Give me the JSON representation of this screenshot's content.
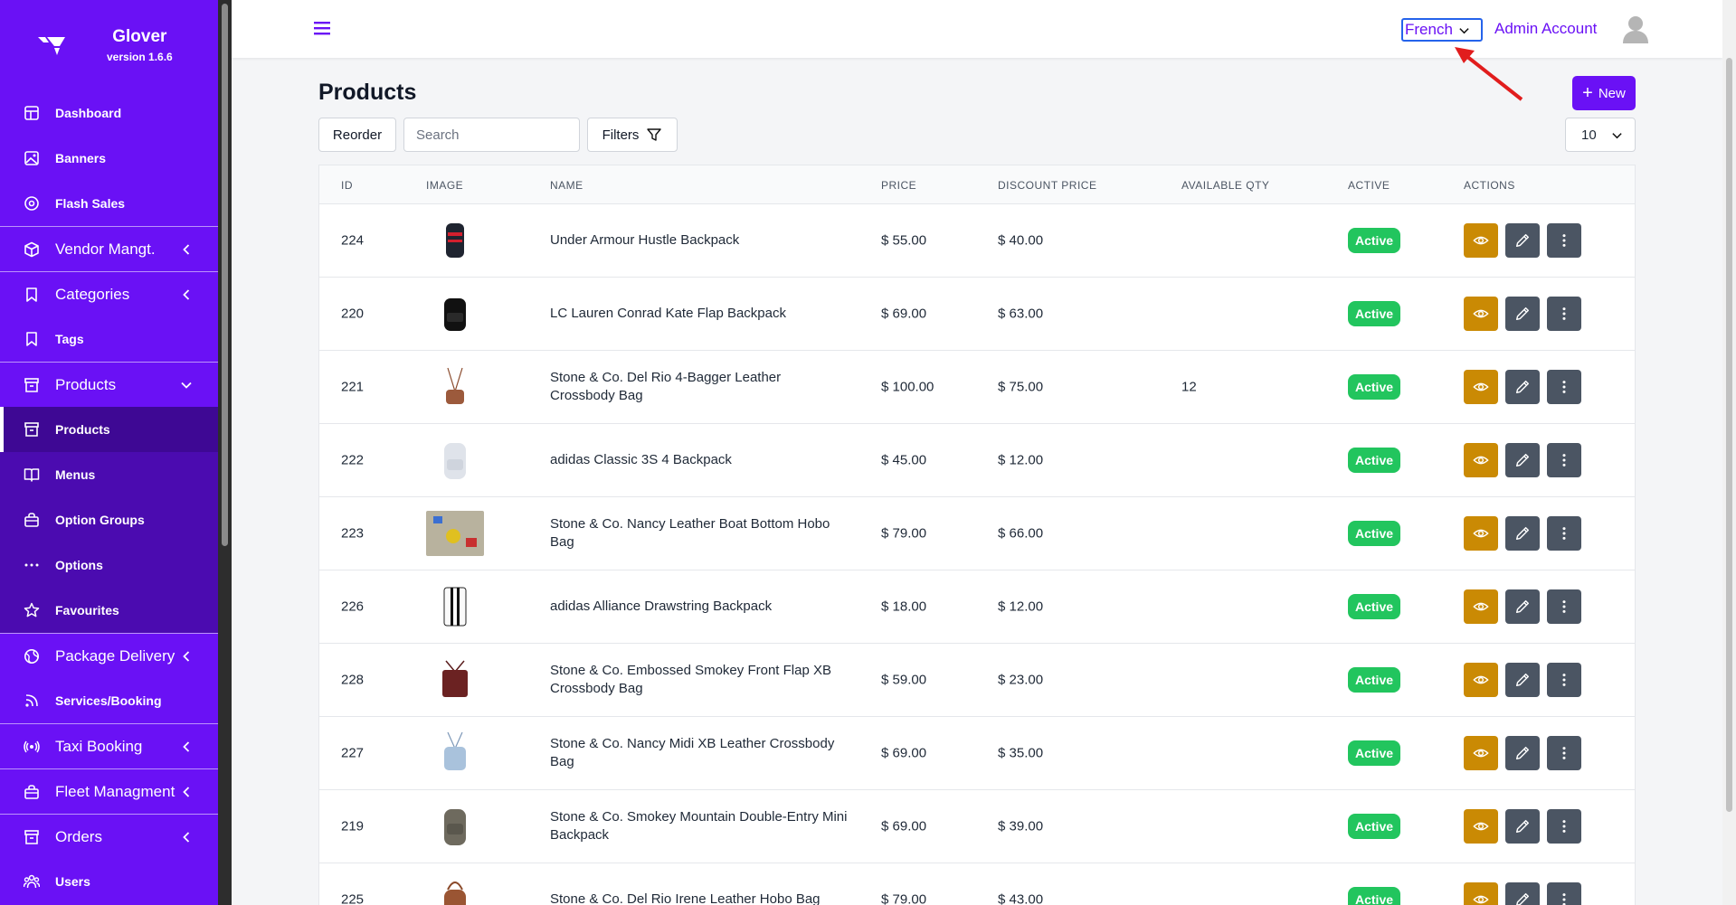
{
  "app": {
    "name": "Glover",
    "version": "version 1.6.6"
  },
  "sidebar": {
    "items": [
      {
        "label": "Dashboard",
        "icon": "dashboard-icon",
        "size": "small"
      },
      {
        "label": "Banners",
        "icon": "image-icon",
        "size": "small"
      },
      {
        "label": "Flash Sales",
        "icon": "flash-icon",
        "size": "small"
      },
      {
        "label": "Vendor Mangt.",
        "icon": "cube-icon",
        "size": "big",
        "chevron": "left"
      },
      {
        "label": "Categories",
        "icon": "bookmark-icon",
        "size": "big",
        "chevron": "left"
      },
      {
        "label": "Tags",
        "icon": "bookmark-icon",
        "size": "small"
      },
      {
        "label": "Products",
        "icon": "archive-icon",
        "size": "big",
        "chevron": "down"
      },
      {
        "label": "Products",
        "icon": "archive-icon",
        "size": "small",
        "active": true
      },
      {
        "label": "Menus",
        "icon": "book-icon",
        "size": "small"
      },
      {
        "label": "Option Groups",
        "icon": "bag-icon",
        "size": "small"
      },
      {
        "label": "Options",
        "icon": "dots-icon",
        "size": "small"
      },
      {
        "label": "Favourites",
        "icon": "star-icon",
        "size": "small"
      },
      {
        "label": "Package Delivery",
        "icon": "globe-icon",
        "size": "big",
        "chevron": "left"
      },
      {
        "label": "Services/Booking",
        "icon": "rss-icon",
        "size": "small"
      },
      {
        "label": "Taxi Booking",
        "icon": "broadcast-icon",
        "size": "big",
        "chevron": "left"
      },
      {
        "label": "Fleet Managment",
        "icon": "bag-icon",
        "size": "big",
        "chevron": "left"
      },
      {
        "label": "Orders",
        "icon": "archive-icon",
        "size": "big",
        "chevron": "left"
      },
      {
        "label": "Users",
        "icon": "users-icon",
        "size": "small"
      }
    ]
  },
  "topbar": {
    "language": "French",
    "account": "Admin Account"
  },
  "page": {
    "title": "Products",
    "new_label": "New",
    "reorder_label": "Reorder",
    "search_placeholder": "Search",
    "filters_label": "Filters",
    "per_page": "10"
  },
  "table": {
    "headers": {
      "id": "ID",
      "image": "IMAGE",
      "name": "NAME",
      "price": "PRICE",
      "discount": "DISCOUNT PRICE",
      "qty": "AVAILABLE QTY",
      "active": "ACTIVE",
      "actions": "ACTIONS"
    },
    "rows": [
      {
        "id": "224",
        "name": "Under Armour Hustle Backpack",
        "price": "$ 55.00",
        "discount": "$ 40.00",
        "qty": "",
        "status": "Active",
        "img": "backpack-red"
      },
      {
        "id": "220",
        "name": "LC Lauren Conrad Kate Flap Backpack",
        "price": "$ 69.00",
        "discount": "$ 63.00",
        "qty": "",
        "status": "Active",
        "img": "backpack-black"
      },
      {
        "id": "221",
        "name": "Stone & Co. Del Rio 4-Bagger Leather Crossbody Bag",
        "price": "$ 100.00",
        "discount": "$ 75.00",
        "qty": "12",
        "status": "Active",
        "img": "crossbody-brown"
      },
      {
        "id": "222",
        "name": "adidas Classic 3S 4 Backpack",
        "price": "$ 45.00",
        "discount": "$ 12.00",
        "qty": "",
        "status": "Active",
        "img": "backpack-white"
      },
      {
        "id": "223",
        "name": "Stone & Co. Nancy Leather Boat Bottom Hobo Bag",
        "price": "$ 79.00",
        "discount": "$ 66.00",
        "qty": "",
        "status": "Active",
        "img": "toys"
      },
      {
        "id": "226",
        "name": "adidas Alliance Drawstring Backpack",
        "price": "$ 18.00",
        "discount": "$ 12.00",
        "qty": "",
        "status": "Active",
        "img": "drawstring"
      },
      {
        "id": "228",
        "name": "Stone & Co. Embossed Smokey Front Flap XB Crossbody Bag",
        "price": "$ 59.00",
        "discount": "$ 23.00",
        "qty": "",
        "status": "Active",
        "img": "crossbody-maroon"
      },
      {
        "id": "227",
        "name": "Stone & Co. Nancy Midi XB Leather Crossbody Bag",
        "price": "$ 69.00",
        "discount": "$ 35.00",
        "qty": "",
        "status": "Active",
        "img": "crossbody-blue"
      },
      {
        "id": "219",
        "name": "Stone & Co. Smokey Mountain Double-Entry Mini Backpack",
        "price": "$ 69.00",
        "discount": "$ 39.00",
        "qty": "",
        "status": "Active",
        "img": "backpack-grey"
      },
      {
        "id": "225",
        "name": "Stone & Co. Del Rio Irene Leather Hobo Bag",
        "price": "$ 79.00",
        "discount": "$ 43.00",
        "qty": "",
        "status": "Active",
        "img": "hobo-brown"
      }
    ]
  },
  "colors": {
    "brand": "#6a11f5",
    "active_badge": "#22c55e",
    "view_btn": "#ca8a04",
    "edit_btn": "#4b5563"
  }
}
